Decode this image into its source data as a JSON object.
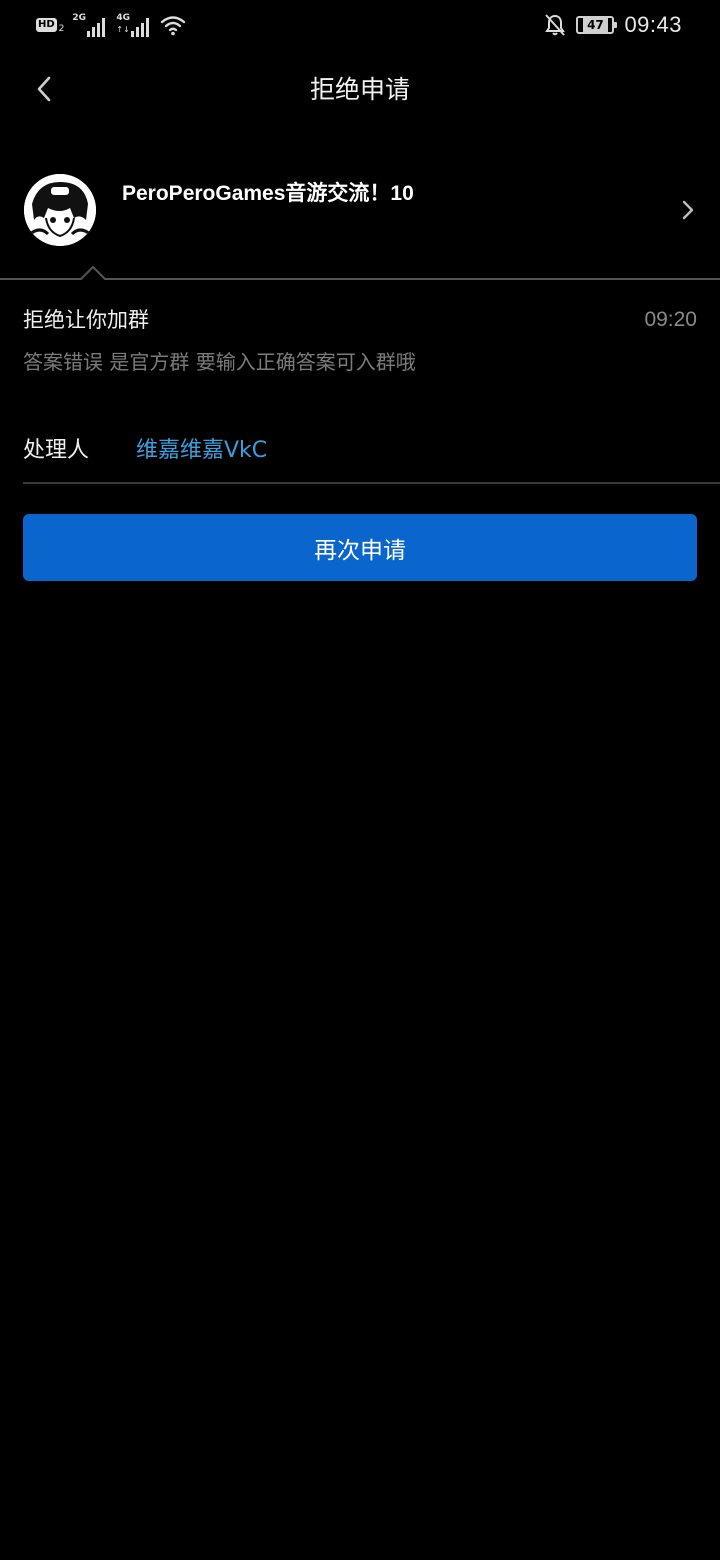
{
  "status_bar": {
    "hd_label": "HD",
    "hd_sub": "2",
    "sim1_gen": "2G",
    "sim2_gen": "4G",
    "sim2_arrows": "↑↓",
    "battery_level": "47",
    "time": "09:43",
    "icons": [
      "signal-icon",
      "wifi-icon",
      "bell-off-icon",
      "battery-icon"
    ]
  },
  "header": {
    "title": "拒绝申请"
  },
  "group": {
    "name": "PeroPeroGames音游交流！10"
  },
  "reason": {
    "title": "拒绝让你加群",
    "time": "09:20",
    "text": "答案错误 是官方群 要输入正确答案可入群哦"
  },
  "handler": {
    "label": "处理人",
    "name": "维嘉维嘉VkC"
  },
  "actions": {
    "reapply_label": "再次申请"
  },
  "colors": {
    "background": "#000000",
    "accent_blue": "#0a66cc",
    "link_blue": "#3a9fde",
    "secondary_text": "#7b7b7b"
  }
}
